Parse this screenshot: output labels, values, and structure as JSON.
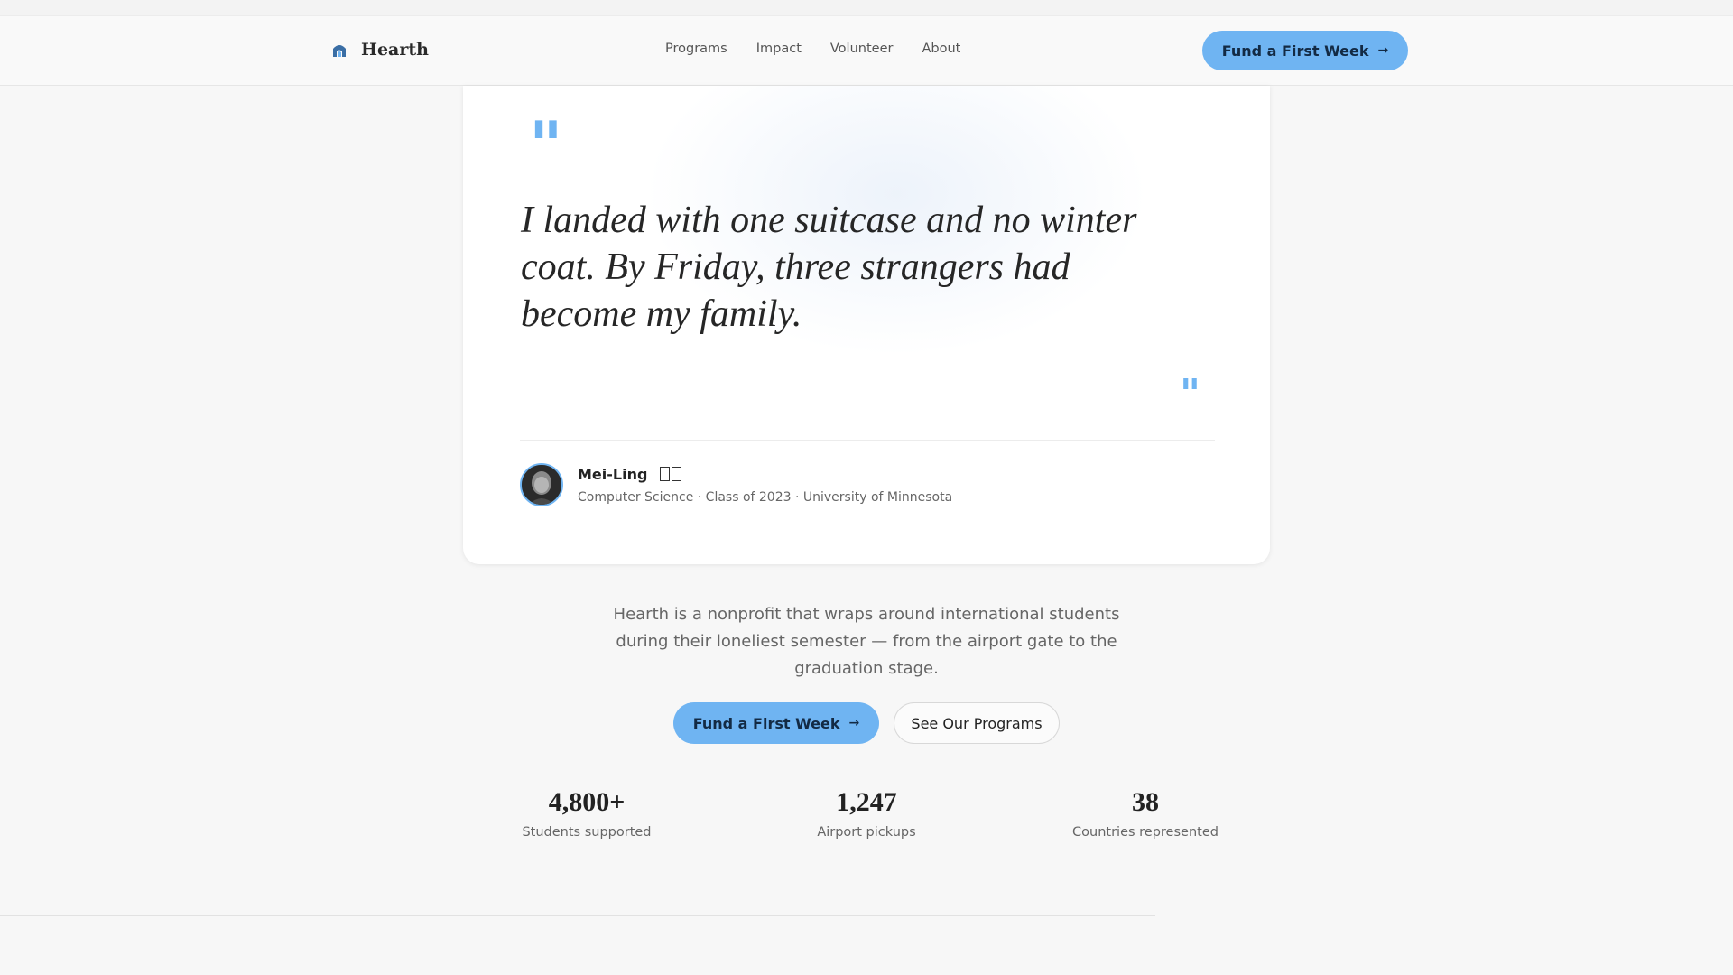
{
  "header": {
    "brand": "Hearth",
    "nav": [
      "Programs",
      "Impact",
      "Volunteer",
      "About"
    ],
    "cta_label": "Fund a First Week",
    "cta_arrow": "→"
  },
  "testimonial": {
    "open_mark": "\"",
    "quote": "I landed with one suitcase and no winter coat. By Friday, three strangers had become my family.",
    "close_mark": "\"",
    "author_name": "Mei-Ling",
    "author_meta": "Computer Science · Class of 2023 · University of Minnesota"
  },
  "mission": "Hearth is a nonprofit that wraps around international students during their loneliest semester — from the airport gate to the graduation stage.",
  "cta": {
    "primary_label": "Fund a First Week",
    "primary_arrow": "→",
    "secondary_label": "See Our Programs"
  },
  "stats": [
    {
      "value": "4,800+",
      "label": "Students supported"
    },
    {
      "value": "1,247",
      "label": "Airport pickups"
    },
    {
      "value": "38",
      "label": "Countries represented"
    }
  ],
  "colors": {
    "accent": "#6fb4f2",
    "background": "#f7f7f7",
    "card": "#ffffff"
  },
  "icons": {
    "brand": "hearth-logo-icon",
    "arrow": "arrow-right-icon"
  }
}
